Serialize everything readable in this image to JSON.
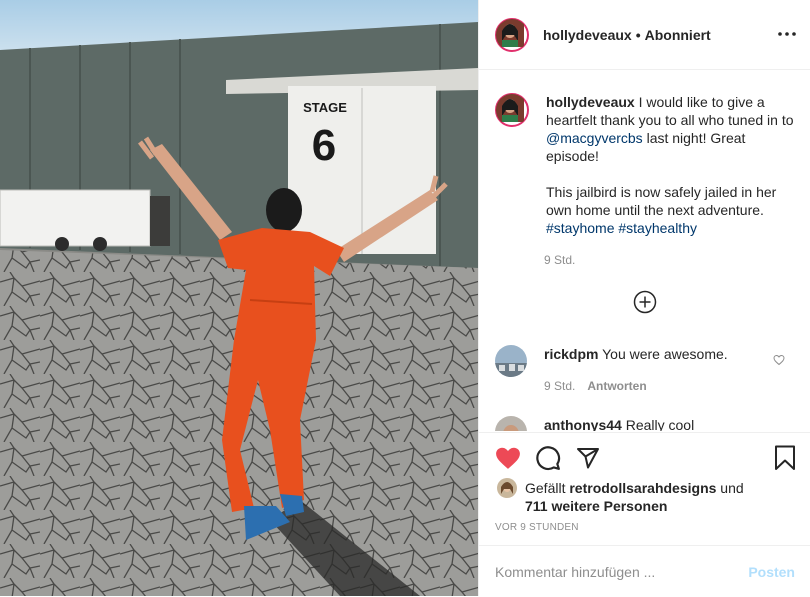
{
  "post": {
    "author": {
      "username": "hollydeveaux",
      "separator": "•",
      "follow_status": "Abonniert"
    },
    "photo": {
      "sign_word": "STAGE",
      "sign_number": "6"
    },
    "caption": {
      "username": "hollydeveaux",
      "line1": " I would like to give a heartfelt thank you to all who tuned in to ",
      "mention": "@macgyvercbs",
      "line1_end": " last night! Great episode!",
      "line2": "This jailbird is now safely jailed in her own home until the next adventure. ",
      "hashtag1": "#stayhome",
      "hashtag_sep": " ",
      "hashtag2": "#stayhealthy",
      "time": "9 Std."
    },
    "comments": [
      {
        "username": "rickdpm",
        "text": " You were awesome.",
        "time": "9 Std.",
        "reply_label": "Antworten"
      },
      {
        "username": "anthonys44",
        "text": " Really cool"
      }
    ],
    "likes": {
      "prefix": "Gefällt ",
      "liker": "retrodollsarahdesigns",
      "connector": " und",
      "others": "711 weitere Personen"
    },
    "date": "VOR 9 STUNDEN",
    "add_comment": {
      "placeholder": "Kommentar hinzufügen ...",
      "post_label": "Posten"
    },
    "colors": {
      "heart_liked": "#ed4956",
      "link": "#00376b",
      "post_button_disabled": "#b2dffc",
      "jumpsuit": "#e8501e"
    }
  }
}
